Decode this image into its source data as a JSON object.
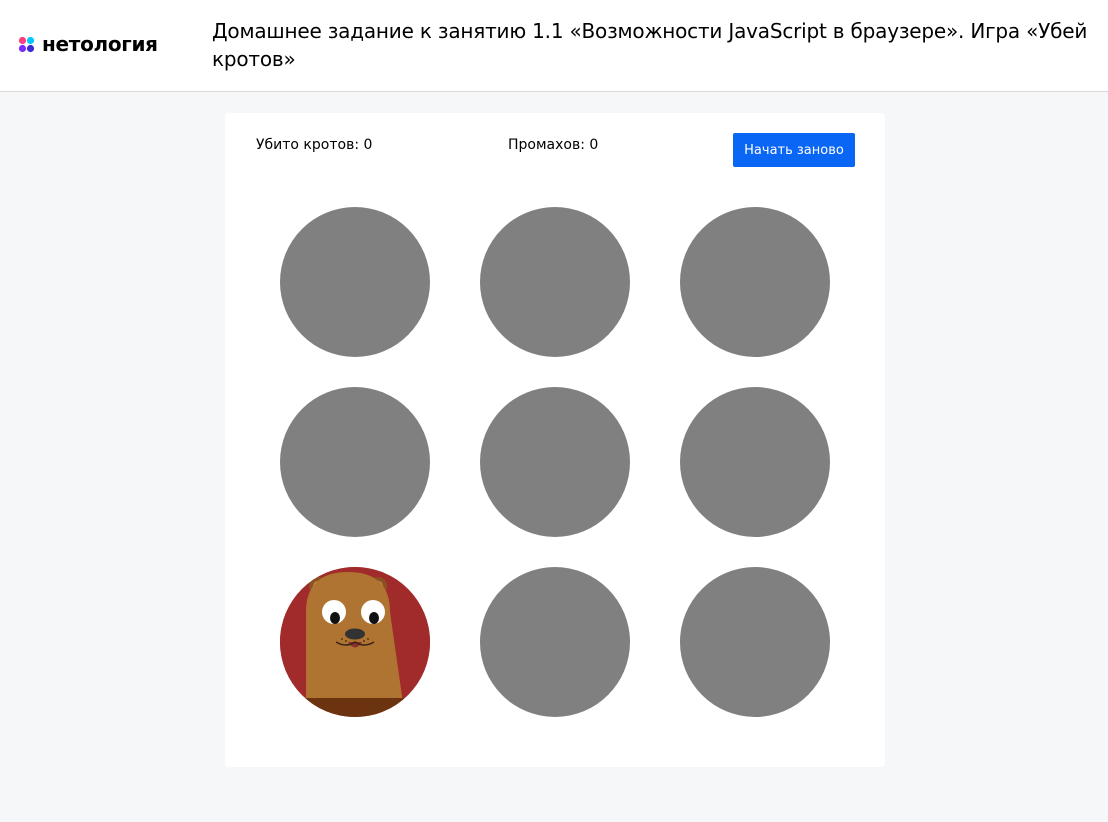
{
  "header": {
    "logo_text": "нетология",
    "title": "Домашнее задание к занятию 1.1 «Возможности JavaScript в браузере». Игра «Убей кротов»"
  },
  "game": {
    "killed_label": "Убито кротов:",
    "killed_value": "0",
    "missed_label": "Промахов:",
    "missed_value": "0",
    "restart_label": "Начать заново",
    "holes": [
      {
        "has_mole": false
      },
      {
        "has_mole": false
      },
      {
        "has_mole": false
      },
      {
        "has_mole": false
      },
      {
        "has_mole": false
      },
      {
        "has_mole": false
      },
      {
        "has_mole": true
      },
      {
        "has_mole": false
      },
      {
        "has_mole": false
      }
    ]
  },
  "colors": {
    "page_background": "#f6f7f9",
    "hole": "#808080",
    "hole_with_mole": "#a12a2a",
    "button": "#0a66f4",
    "mole_body": "#b07432",
    "ground": "#6b3310"
  },
  "icons": [
    "netology-logo-icon",
    "mole-icon"
  ]
}
